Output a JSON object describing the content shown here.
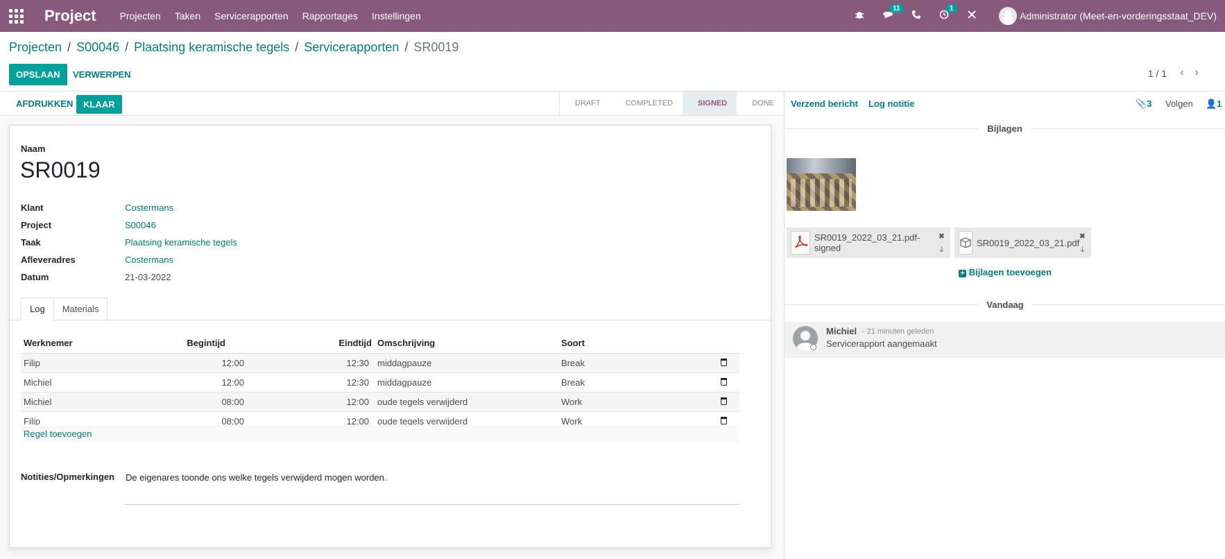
{
  "navbar": {
    "brand": "Project",
    "menu": [
      "Projecten",
      "Taken",
      "Servicerapporten",
      "Rapportages",
      "Instellingen"
    ],
    "messages_badge": "11",
    "activities_badge": "1",
    "user": "Administrator (Meet-en-vorderingsstaat_DEV)"
  },
  "breadcrumb": {
    "items": [
      "Projecten",
      "S00046",
      "Plaatsing keramische tegels",
      "Servicerapporten"
    ],
    "current": "SR0019"
  },
  "actions": {
    "save": "OPSLAAN",
    "discard": "VERWERPEN",
    "pager": "1 / 1"
  },
  "statusbar": {
    "print": "AFDRUKKEN",
    "done_btn": "KLAAR",
    "stages": [
      "DRAFT",
      "COMPLETED",
      "SIGNED",
      "DONE"
    ],
    "active_stage": "SIGNED"
  },
  "form": {
    "name_label": "Naam",
    "name": "SR0019",
    "fields": [
      {
        "label": "Klant",
        "value": "Costermans"
      },
      {
        "label": "Project",
        "value": "S00046"
      },
      {
        "label": "Taak",
        "value": "Plaatsing keramische tegels"
      },
      {
        "label": "Afleveradres",
        "value": "Costermans"
      },
      {
        "label": "Datum",
        "value": "21-03-2022"
      }
    ],
    "tabs": [
      "Log",
      "Materials"
    ],
    "table": {
      "headers": [
        "Werknemer",
        "Begintijd",
        "Eindtijd",
        "Omschrijving",
        "Soort"
      ],
      "rows": [
        [
          "Filip",
          "12:00",
          "12:30",
          "middagpauze",
          "Break"
        ],
        [
          "Michiel",
          "12:00",
          "12:30",
          "middagpauze",
          "Break"
        ],
        [
          "Michiel",
          "08:00",
          "12:00",
          "oude tegels verwijderd",
          "Work"
        ],
        [
          "Filip",
          "08:00",
          "12:00",
          "oude tegels verwijderd",
          "Work"
        ]
      ],
      "add_line": "Regel toevoegen"
    },
    "notes_label": "Notities/Opmerkingen",
    "notes": "De eigenares toonde ons welke tegels verwijderd mogen worden."
  },
  "chatter": {
    "send_message": "Verzend bericht",
    "log_note": "Log notitie",
    "attachments_count": "3",
    "follow": "Volgen",
    "followers_count": "1",
    "attachments_title": "Bijlagen",
    "files": [
      "SR0019_2022_03_21.pdf-signed",
      "SR0019_2022_03_21.pdf"
    ],
    "add_attachments": "Bijlagen toevoegen",
    "today": "Vandaag",
    "message": {
      "author": "Michiel",
      "date": "- 21 minuten geleden",
      "body": "Servicerapport aangemaakt"
    }
  },
  "colors": {
    "brand": "#875a7b",
    "accent": "#00a09d",
    "link": "#017e84"
  }
}
